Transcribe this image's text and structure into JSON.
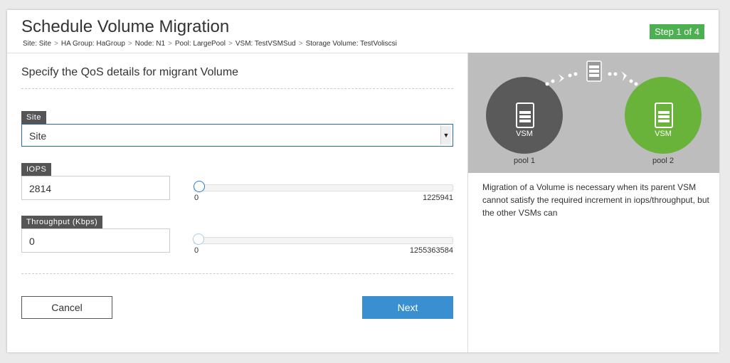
{
  "header": {
    "title": "Schedule Volume Migration",
    "step": "Step 1 of 4",
    "breadcrumb": [
      "Site: Site",
      "HA Group: HaGroup",
      "Node: N1",
      "Pool: LargePool",
      "VSM: TestVSMSud",
      "Storage Volume: TestVoliscsi"
    ],
    "separator": ">"
  },
  "form": {
    "subtitle": "Specify the QoS details for migrant Volume",
    "site": {
      "label": "Site",
      "value": "Site"
    },
    "iops": {
      "label": "IOPS",
      "value": "2814",
      "min": "0",
      "max": "1225941",
      "fraction": 0.0023
    },
    "throughput": {
      "label": "Throughput (Kbps)",
      "value": "0",
      "min": "0",
      "max": "1255363584",
      "fraction": 0
    },
    "cancel_label": "Cancel",
    "next_label": "Next"
  },
  "illustration": {
    "source_label": "VSM",
    "target_label": "VSM",
    "source_pool": "pool 1",
    "target_pool": "pool 2"
  },
  "description": "Migration of a Volume is necessary when its parent VSM cannot satisfy the required increment in iops/throughput, but the other VSMs can",
  "colors": {
    "accent": "#3a8fd0",
    "step_badge": "#4caf50",
    "source_vsm": "#5a5a5a",
    "target_vsm": "#69b33a"
  }
}
